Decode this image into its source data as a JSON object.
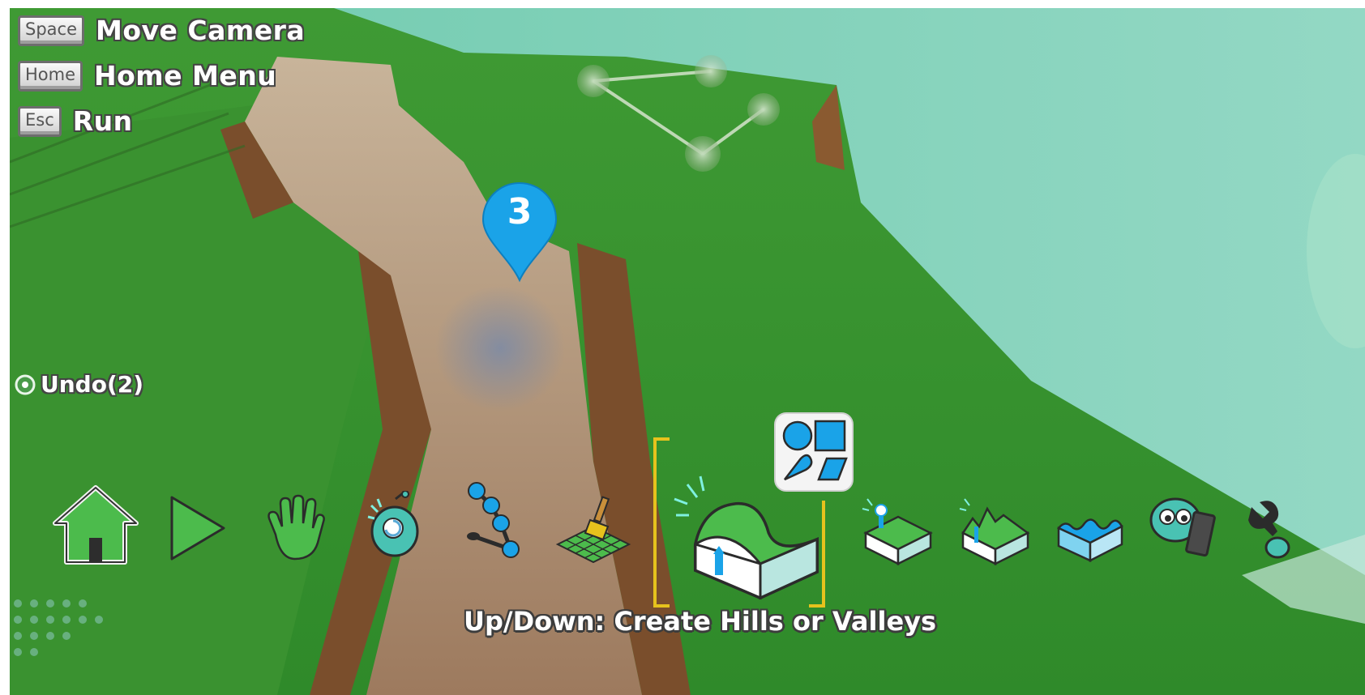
{
  "controls": [
    {
      "key": "Space",
      "label": "Move Camera"
    },
    {
      "key": "Home",
      "label": "Home Menu"
    },
    {
      "key": "Esc",
      "label": "Run"
    }
  ],
  "undo": {
    "label": "Undo(2)"
  },
  "marker": {
    "number": "3",
    "color": "#1aa3e8"
  },
  "toolbar": {
    "tools": [
      {
        "name": "home-menu",
        "icon": "house-icon"
      },
      {
        "name": "run",
        "icon": "play-icon"
      },
      {
        "name": "move",
        "icon": "hand-icon"
      },
      {
        "name": "object",
        "icon": "kodu-robot-icon"
      },
      {
        "name": "paths",
        "icon": "path-nodes-icon"
      },
      {
        "name": "paint-terrain",
        "icon": "brush-grid-icon"
      },
      {
        "name": "up-down-terrain",
        "icon": "hill-valley-icon",
        "selected": true
      },
      {
        "name": "flatten-terrain",
        "icon": "terrain-flatten-icon"
      },
      {
        "name": "roughen-terrain",
        "icon": "terrain-roughen-icon"
      },
      {
        "name": "water",
        "icon": "water-icon"
      },
      {
        "name": "delete-objects",
        "icon": "eraser-icon"
      },
      {
        "name": "world-settings",
        "icon": "wrench-icon"
      }
    ],
    "brush_popup_icon": "brush-shapes-icon",
    "selection_color": "#e6c21d"
  },
  "hint": "Up/Down: Create Hills or Valleys"
}
